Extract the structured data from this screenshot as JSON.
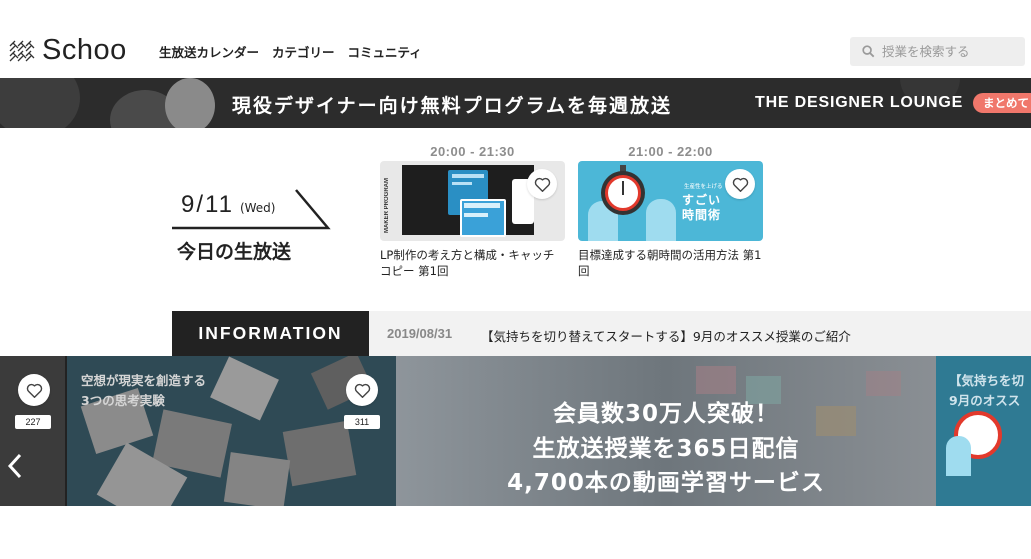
{
  "header": {
    "logo_text": "Schoo",
    "nav": [
      {
        "label": "生放送カレンダー"
      },
      {
        "label": "カテゴリー"
      },
      {
        "label": "コミュニティ"
      }
    ],
    "search_placeholder": "授業を検索する"
  },
  "banner": {
    "title": "現役デザイナー向け無料プログラムを毎週放送",
    "brand": "THE DESIGNER LOUNGE",
    "pill": "まとめて"
  },
  "today": {
    "date": "9/11",
    "weekday": "(Wed)",
    "label": "今日の生放送",
    "cards": [
      {
        "time": "20:00 - 21:30",
        "title": "LP制作の考え方と構成・キャッチコピー 第1回",
        "thumb_text": "MAKER PROGRAM"
      },
      {
        "time": "21:00 - 22:00",
        "title": "目標達成する朝時間の活用方法 第1回",
        "thumb_small": "生産性を上げる",
        "thumb_big_1": "すごい",
        "thumb_big_2": "時間術"
      }
    ]
  },
  "information": {
    "label": "INFORMATION",
    "date": "2019/08/31",
    "text": "【気持ちを切り替えてスタートする】9月のオススメ授業のご紹介"
  },
  "carousel": {
    "slides": [
      {
        "count": "227"
      },
      {
        "count": "311",
        "caption_1": "空想が現実を創造する",
        "caption_2": "3つの思考実験"
      },
      {
        "hero_1": "会員数30万人突破！",
        "hero_2": "生放送授業を365日配信",
        "hero_3": "4,700本の動画学習サービス"
      },
      {
        "caption_1": "【気持ちを切",
        "caption_2": "9月のオスス"
      }
    ]
  },
  "colors": {
    "banner_bg": "#2c2c2c",
    "pill": "#f0776b",
    "info_label_bg": "#222222",
    "info_bar_bg": "#f2f2f2"
  }
}
